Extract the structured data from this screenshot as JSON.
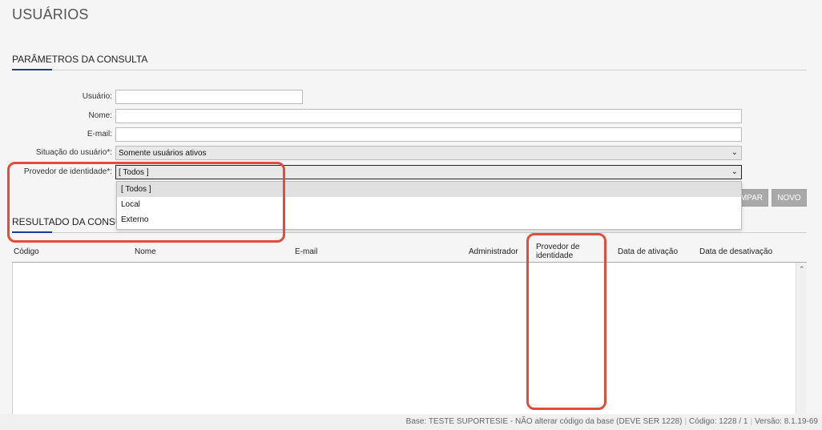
{
  "page": {
    "title": "USUÁRIOS"
  },
  "params_section": {
    "title": "PARÂMETROS DA CONSULTA"
  },
  "form": {
    "usuario": {
      "label": "Usuário:",
      "value": ""
    },
    "nome": {
      "label": "Nome:",
      "value": ""
    },
    "email": {
      "label": "E-mail:",
      "value": ""
    },
    "situacao": {
      "label": "Situação do usuário*:",
      "value": "Somente usuários ativos"
    },
    "provedor": {
      "label": "Provedor de identidade*:",
      "value": "[ Todos ]",
      "options": [
        "[ Todos ]",
        "Local",
        "Externo"
      ]
    }
  },
  "buttons": {
    "limpar": "LIMPAR",
    "limpar_visible": "MPAR",
    "novo": "NOVO"
  },
  "result_section": {
    "title": "RESULTADO DA CONSULTA",
    "title_visible": "RESULTADO DA CONSU"
  },
  "grid": {
    "columns": [
      "Código",
      "Nome",
      "E-mail",
      "Administrador",
      "Provedor de identidade",
      "Data de ativação",
      "Data de desativação"
    ],
    "rows": []
  },
  "status_bar": {
    "base": "Base: TESTE SUPORTESIE - NÃO alterar código da base (DEVE SER 1228)",
    "codigo": "Código: 1228 / 1",
    "versao": "Versão: 8.1.19-69"
  },
  "colors": {
    "accent": "#1f3a93",
    "highlight": "#e14c3c",
    "button": "#a9a9a9"
  }
}
